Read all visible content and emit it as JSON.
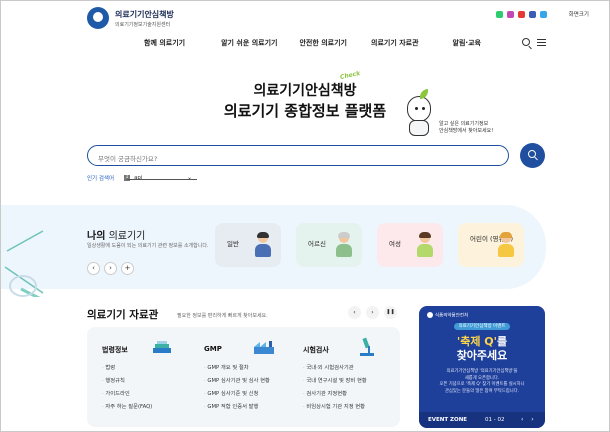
{
  "header": {
    "logo_title": "의료기기안심책방",
    "logo_sub": "의료기기정보기술지원센터",
    "zoom_label": "화면크기",
    "nav": [
      "함께 의료기기",
      "알기 쉬운 의료기기",
      "안전한 의료기기",
      "의료기기 자료관",
      "알림·교육"
    ]
  },
  "hero": {
    "line1": "의료기기안심책방",
    "line2": "의료기기 종합정보 플랫폼",
    "check_tag": "Check",
    "bubble_line1": "알고 싶은 의료기기정보",
    "bubble_line2": "안심책방에서 찾아보세요!"
  },
  "search": {
    "placeholder": "무엇이 궁금하신가요?",
    "popular_label": "인기 검색어",
    "popular_rank": "1",
    "popular_word": "api"
  },
  "my_device": {
    "title_bold": "나의",
    "title_rest": " 의료기기",
    "desc": "일상생활에 도움이 되는 의료기기 관련 정보를 소개합니다.",
    "prev": "‹",
    "next": "›",
    "add": "+",
    "cards": [
      {
        "label": "일반",
        "bg": "#e6ecf2"
      },
      {
        "label": "어르신",
        "bg": "#e5f3ef"
      },
      {
        "label": "여성",
        "bg": "#fde8ec"
      },
      {
        "label": "어린이 (영유아)",
        "bg": "#fdf3dc"
      }
    ]
  },
  "library": {
    "title": "의료기기 자료관",
    "desc": "필요한 정보를 편리하게 빠르게 찾아보세요.",
    "controls": [
      "‹",
      "›",
      "❚❚"
    ],
    "columns": [
      {
        "title": "법령정보",
        "items": [
          "법령",
          "행정규칙",
          "가이드라인",
          "자주 하는 질문(FAQ)"
        ]
      },
      {
        "title": "GMP",
        "items": [
          "GMP 개요 및 절차",
          "GMP 심사기관 및 심사 현황",
          "GMP 심사기준 및 신청",
          "GMP 적합 인증서 발행"
        ]
      },
      {
        "title": "시험검사",
        "items": [
          "국내·외 시험검사기관",
          "국내 연구시설 및 장비 현황",
          "검사기관 지정현황",
          "비임상시험 기관 지정 현황"
        ]
      }
    ]
  },
  "event": {
    "org": "식품의약품안전처",
    "sub": "의료기기안심책방 이벤트",
    "main1_q": "'축제 Q'",
    "main1_rest": "를",
    "main2": "찾아주세요",
    "p1": "의료기기안심책방 '의료기기안심책방'을",
    "p2": "새롭게 오픈합니다.",
    "p3": "오픈 기념으로 '축제 Q' 찾기 이벤트를 실시하니",
    "p4": "관심있는 분들의 많은 참여 부탁드립니다.",
    "zone": "EVENT ZONE",
    "page": "01 - 02",
    "arrows": "‹ ›"
  },
  "colors": {
    "primary": "#1f4f9e",
    "sky": "#eef6fd",
    "event_bg": "#1e3f9a"
  }
}
